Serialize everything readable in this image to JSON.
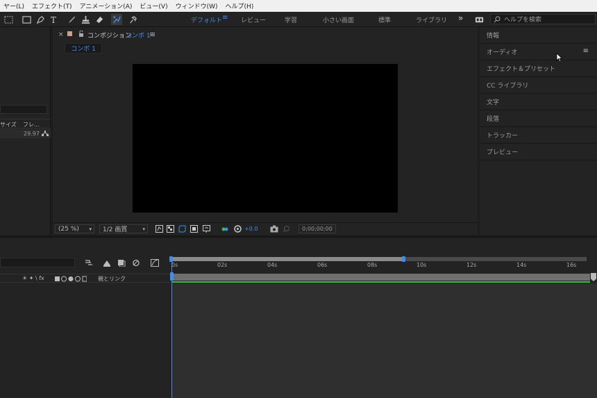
{
  "menu": [
    "ヤー(L)",
    "エフェクト(T)",
    "アニメーション(A)",
    "ビュー(V)",
    "ウィンドウ(W)",
    "ヘルプ(H)"
  ],
  "workspaces": {
    "items": [
      "デフォルト",
      "レビュー",
      "学習",
      "小さい画面",
      "標準",
      "ライブラリ"
    ],
    "overflow": "»"
  },
  "search": {
    "placeholder": "ヘルプを検索"
  },
  "project": {
    "col_size": "サイズ",
    "col_frame": "フレ...",
    "row_fps": "29.97"
  },
  "composition": {
    "close": "×",
    "lock": "🔓",
    "prefix": "コンポジション",
    "name": "コンポ 1",
    "menu": "≡",
    "tab": "コンポ 1",
    "zoom": "(25 %)",
    "resolution": "1/2 画質",
    "exposure": "+0.0",
    "timecode": "0;00;00;00"
  },
  "right_panel": {
    "items": [
      "情報",
      "オーディオ",
      "エフェクト＆プリセット",
      "CC ライブラリ",
      "文字",
      "段落",
      "トラッカー",
      "プレビュー"
    ],
    "menu": "≡"
  },
  "timeline": {
    "ticks": [
      "0s",
      "02s",
      "04s",
      "06s",
      "08s",
      "10s",
      "12s",
      "14s",
      "16s"
    ],
    "parent_link_label": "親とリンク",
    "switch_icons": "☀ ✦ \\ fx"
  },
  "colors": {
    "accent": "#3d8ef0",
    "green_line": "#3fbf3f",
    "label_chip": "#c9a08a"
  }
}
